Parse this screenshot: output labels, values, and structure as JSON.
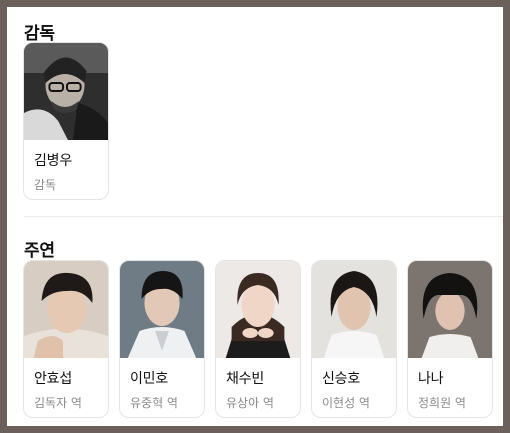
{
  "director_section": {
    "title": "감독",
    "people": [
      {
        "name": "김병우",
        "role": "감독"
      }
    ]
  },
  "cast_section": {
    "title": "주연",
    "people": [
      {
        "name": "안효섭",
        "role": "김독자 역"
      },
      {
        "name": "이민호",
        "role": "유중혁 역"
      },
      {
        "name": "채수빈",
        "role": "유상아 역"
      },
      {
        "name": "신승호",
        "role": "이현성 역"
      },
      {
        "name": "나나",
        "role": "정희원 역"
      }
    ]
  }
}
